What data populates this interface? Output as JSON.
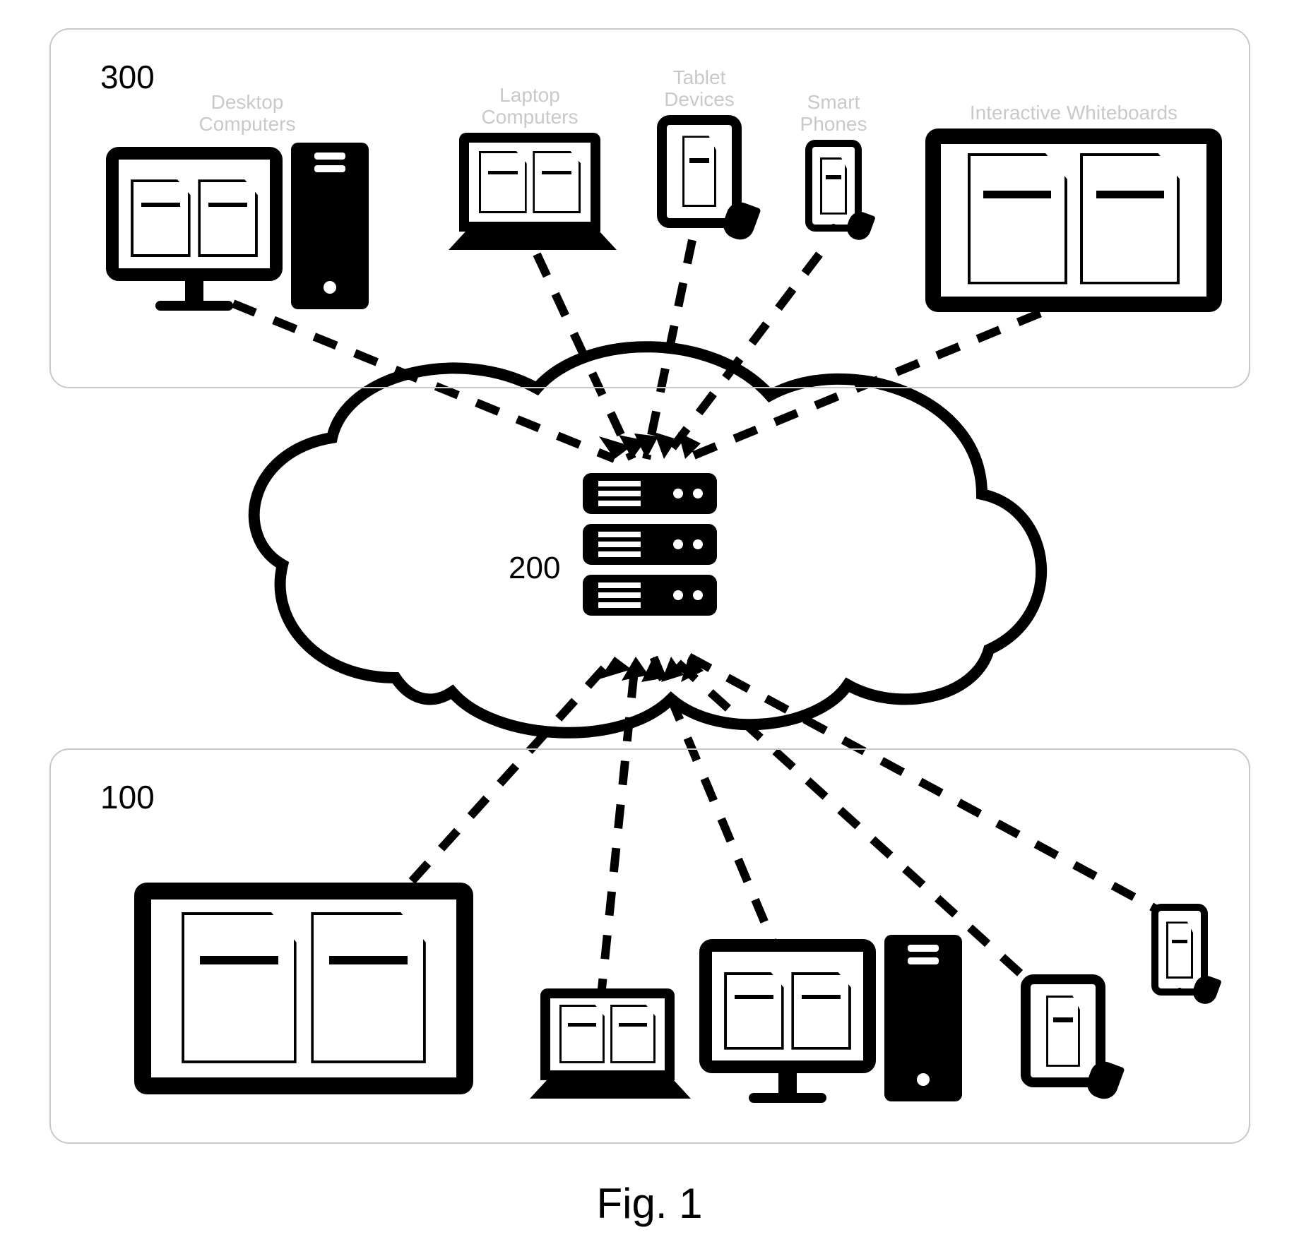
{
  "figure_caption": "Fig. 1",
  "panel_top": {
    "ref": "300"
  },
  "panel_bottom": {
    "ref": "100"
  },
  "cloud": {
    "ref": "200"
  },
  "top_devices": {
    "desktop": {
      "label": "Desktop\nComputers"
    },
    "laptop": {
      "label": "Laptop\nComputers"
    },
    "tablet": {
      "label": "Tablet\nDevices"
    },
    "phone": {
      "label": "Smart\nPhones"
    },
    "whiteboard": {
      "label": "Interactive Whiteboards"
    }
  }
}
